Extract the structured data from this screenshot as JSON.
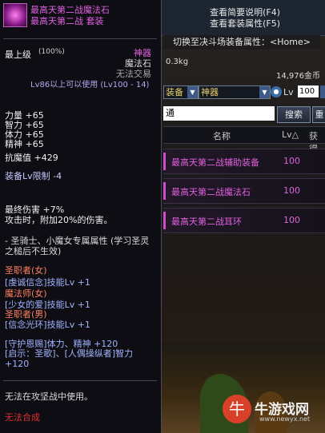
{
  "hints": {
    "detail": "查看简要说明(F4)",
    "set": "查看套装属性(F5)"
  },
  "switch_bar": "切换至决斗场装备属性：<Home>",
  "weight": "0.3kg",
  "gold": "14,976金币",
  "filters": {
    "type": "装备",
    "grade": "神器",
    "lv_label": "Lv",
    "lv_value": "100"
  },
  "search": {
    "value": "通",
    "button": "搜索",
    "reset": "重"
  },
  "table": {
    "headers": [
      "名称",
      "Lv△",
      "获得"
    ],
    "rows": [
      {
        "name": "最高天第二战辅助装备",
        "lv": "100"
      },
      {
        "name": "最高天第二战魔法石",
        "lv": "100"
      },
      {
        "name": "最高天第二战耳环",
        "lv": "100"
      }
    ]
  },
  "tooltip": {
    "name": "最高天第二战魔法石",
    "set_line": "最高天第二战  套装",
    "grade": "神器",
    "top_level": "最上级",
    "top_pct": "(100%)",
    "item_type": "魔法石",
    "trade": "无法交易",
    "level_req": "Lv86以上可以使用 (Lv100 - 14)",
    "stats": [
      "力量 +65",
      "智力 +65",
      "体力 +65",
      "精神 +65"
    ],
    "resist": "抗魔值 +429",
    "level_limit": "装备Lv限制 -4",
    "dmg1": "最终伤害 +7%",
    "dmg2": "攻击时，附加20%的伤害。",
    "note": "- 圣骑士、小魔女专属属性 (学习圣灵之槌后不生效)",
    "classes": [
      "圣职者(女)",
      "[虔诚信念]技能Lv +1",
      "魔法师(女)",
      "[少女的爱]技能Lv +1",
      "圣职者(男)",
      "[信念光环]技能Lv +1"
    ],
    "bonus1": "[守护恩赐]体力、精神 +120",
    "bonus2": "[启示：圣歌]、[人偶操纵者]智力 +120",
    "no_use": "无法在攻坚战中使用。",
    "no_synth": "无法合成"
  },
  "watermark": {
    "logo": "牛",
    "text": "牛游戏网",
    "url": "www.newyx.net"
  },
  "colors": {
    "epic": "#e060e0",
    "skill": "#a0b4ff",
    "class": "#ff8060",
    "warning": "#e03030"
  }
}
